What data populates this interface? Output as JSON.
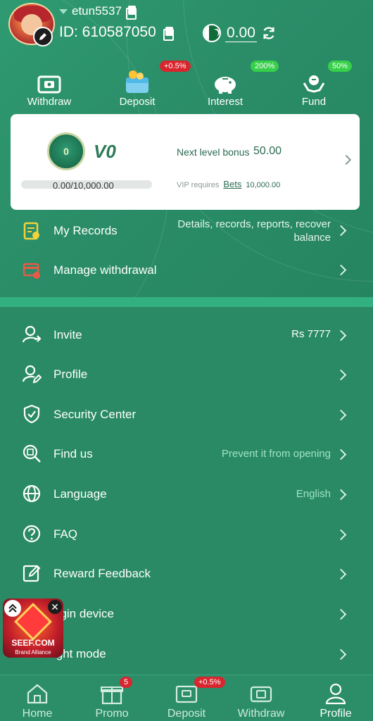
{
  "header": {
    "username": "etun5537",
    "id_text": "ID: 610587050",
    "balance": "0.00"
  },
  "quick_actions": [
    {
      "label": "Withdraw",
      "icon": "withdraw-ticket-icon",
      "badge": ""
    },
    {
      "label": "Deposit",
      "icon": "deposit-wallet-icon",
      "badge": "+0.5%"
    },
    {
      "label": "Interest",
      "icon": "piggy-bank-icon",
      "badge": "200%"
    },
    {
      "label": "Fund",
      "icon": "fund-hands-icon",
      "badge": "50%"
    }
  ],
  "vip": {
    "level": "V0",
    "medal_text": "0",
    "progress_text": "0.00/10,000.00",
    "progress_fraction": 0.0,
    "next_label": "Next level bonus",
    "next_value": "50.00",
    "requires_label": "VIP requires",
    "requires_link": "Bets",
    "requires_value": "10,000.00"
  },
  "records_section": [
    {
      "label": "My Records",
      "right": "Details, records, reports, recover balance",
      "icon": "records-icon"
    },
    {
      "label": "Manage withdrawal",
      "right": "",
      "icon": "manage-withdrawal-icon"
    }
  ],
  "menu": [
    {
      "label": "Invite",
      "right": "Rs 7777",
      "icon": "invite-user-icon"
    },
    {
      "label": "Profile",
      "right": "",
      "icon": "profile-edit-icon"
    },
    {
      "label": "Security Center",
      "right": "",
      "icon": "shield-check-icon"
    },
    {
      "label": "Find us",
      "right": "Prevent it from opening",
      "icon": "find-search-icon"
    },
    {
      "label": "Language",
      "right": "English",
      "icon": "globe-icon"
    },
    {
      "label": "FAQ",
      "right": "",
      "icon": "question-icon"
    },
    {
      "label": "Reward Feedback",
      "right": "",
      "icon": "feedback-edit-icon"
    },
    {
      "label": "ogin device",
      "right": "",
      "icon": "login-device-icon"
    },
    {
      "label": "ight mode",
      "right": "",
      "icon": "night-mode-icon"
    }
  ],
  "float_ad": {
    "brand": "SEEF.COM",
    "sub": "Brand Alliance"
  },
  "nav": [
    {
      "label": "Home",
      "icon": "home-icon",
      "badge": ""
    },
    {
      "label": "Promo",
      "icon": "gift-icon",
      "badge": "5"
    },
    {
      "label": "Deposit",
      "icon": "deposit-wallet-icon",
      "badge": "+0.5%"
    },
    {
      "label": "Withdraw",
      "icon": "withdraw-ticket-icon",
      "badge": ""
    },
    {
      "label": "Profile",
      "icon": "profile-person-icon",
      "badge": ""
    }
  ],
  "colors": {
    "primary": "#2a8a66",
    "band": "#33b07f",
    "badge_red": "#d8262f",
    "badge_green": "#36d04a",
    "right_text": "#9fe3c3"
  }
}
